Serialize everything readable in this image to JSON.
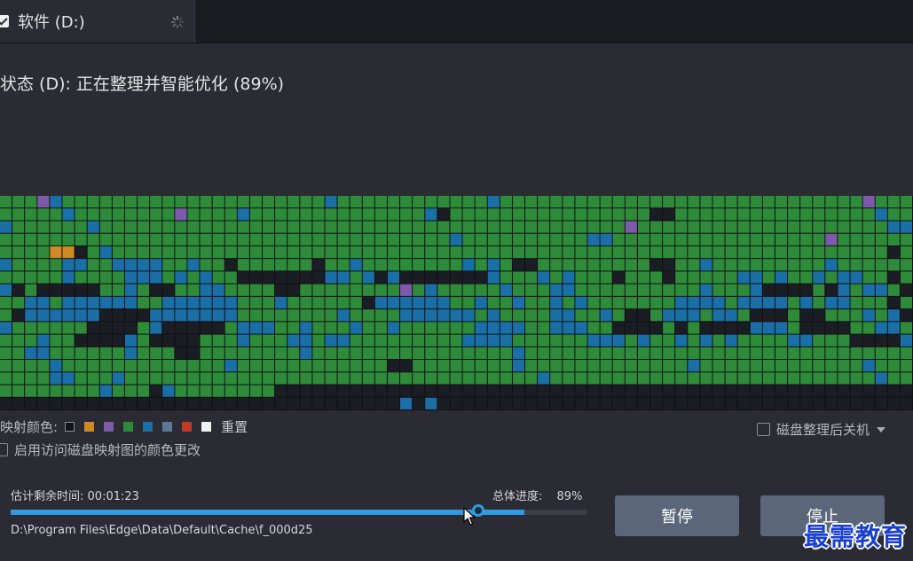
{
  "tab": {
    "label": "软件 (D:)",
    "check_icon": "checkbox-checked-icon",
    "spinner_icon": "loading-spinner-icon"
  },
  "status": {
    "text": "状态 (D): 正在整理并智能优化 (89%)"
  },
  "legend": {
    "label": "映射颜色:",
    "colors": [
      "#111318",
      "#d08a27",
      "#7d5aaa",
      "#2e8b3a",
      "#1a6fa6",
      "#5d7894",
      "#c0392b",
      "#f2f2f2"
    ],
    "reset": "重置"
  },
  "options": {
    "enable_color_change": "启用访问磁盘映射图的颜色更改",
    "shutdown_after": "磁盘整理后关机"
  },
  "progress": {
    "eta_label": "估计剩余时间:",
    "eta_value": "00:01:23",
    "overall_label": "总体进度:",
    "overall_value": "89%",
    "fraction": 0.89,
    "handle_fraction": 0.81,
    "current_file": "D:\\Program Files\\Edge\\Data\\Default\\Cache\\f_000d25"
  },
  "buttons": {
    "pause": "暂停",
    "stop": "停止"
  },
  "watermark": "最需教育",
  "diskmap": {
    "rows": 17,
    "cols": 73,
    "palette": {
      "G": "#2e8b3a",
      "B": "#1a6fa6",
      "K": "#1b1d24",
      "P": "#7d5aaa",
      "O": "#d08a27",
      "S": "#5d7894"
    },
    "cells": [
      "GGGPBGGGGGGGGGGGGGGGGGGGGGBGGGGGGGGGGGGBGGGGGGGGGGGGGGGGGGGGGGGGGGGGGPGGG",
      "GGGGGBGGGGGGGGPGGGGBGGGGGGGGGGGGGGBKGGGGGGGGGGGGGGGGKKGGGGGGGGGGGGGGGGBGGGGGGGGGGGGGGGGBGGBBGGGGGGGGGGGGBGGGG",
      "BGGGGGGBGGGGGGGGGGGGGGGGGGGGGGGGGGGGGGGGGGGGGGGGGGPGGGGGGGGGGGGGGGGGGGGBBGGBGKKKKKGGGGBBGBGGGGGGGGGGG",
      "GGGGGGGGGGGGGGGGGGGGGGGGGGGGGGGGGGGGBGGGGGGGGGGBBGGGGGGGGGGGGGGGGGPGGGGGGGGGGGGGGGGGGGGGGGGGGGBGGGG",
      "GGGGOOKGBGGGGGGGGGGGGGGGGGGGGGGGGGGGGGGGGGGGGGGGGGGGGGGGGGGGGGGGGGGGGGGKGBG",
      "BGGGGBBGGBBBBGGBGGKGGGGGGKGGBGGGGGGGGBGBGKKGGGGGGGGGKKGGBGGGGGGGGGBGGGGGG",
      "GGGGGBGGGGBBBGBGBGGKKKKKKKBBGBKBKKKKKKKBGGGBGBGGGKGGGKGGGGGBBGBGGBGBBGGKG",
      "BKGKKKKKGGBGKKGGBBGGGGKKGGGGGGGGPGBGGGGGBGGGBBGGGGGGGGGGBGGGBKKKKGKBGBBGK",
      "GGBBGBBBBBBGGBBBBBBGGGBGGGGGGKBBBBBBGGBGGBGGBGBGGGGGGGBBBBGBBBBGBGBBGGGKG",
      "GKBBBBBBKKKKBBBBBBBGGGGGGGGBGGGGBBBBBBGBGGGGBBGGBGKKGBBBGBBGKKKGKKGGGBGBK",
      "BGGGGGGKKKKGBKKKKKGBBBGGBGGGBGGBGGGGGGBBBBGGBBBGGKKKKGKGKKKKBBBGKKKKGGBBG",
      "GGGBGGKKKKBGKKKKGGGBGGGBBGBBGGGGGGGGGBBBBGGGGGGBBBGBGGBGBGBGGGGBBGGGKKKKB",
      "GGBBGGGGGGBGGGKKGGGGGGGGBGGGGGGGGGGGGGGGGBGGGGGGGGGGGGGGGGGGGGGGGGGGGGGG",
      "GGGGBGGGGGGGGGGGGGBGGGGGGGGGGGGKKGGGGGGGGBGGGGGGGGGGGGGBGGGGGGGGGGGGGBGGGG",
      "GGGGBBGGGBGGGGGGGGGGGGGGGGGGGGGGGGGGGGGGGGGBGGGGGGGGGGGGGGGGGGGGGGGGGGBGGB",
      "GGGGGGGGBGGGKBGGGGGGGGKKKKKKKKKKKKKKKKKKKKKKKKKKKKKKKKKKKKKKKKKKKKKKKKKKKKBB",
      "KKKKKKKKKKKKKKKKKKKKKKKKKKKKKKKKBKBKKKKKKKKKKKKKKKKKKKKKKKKKKKKKKKKKKKKKKKKK"
    ]
  }
}
